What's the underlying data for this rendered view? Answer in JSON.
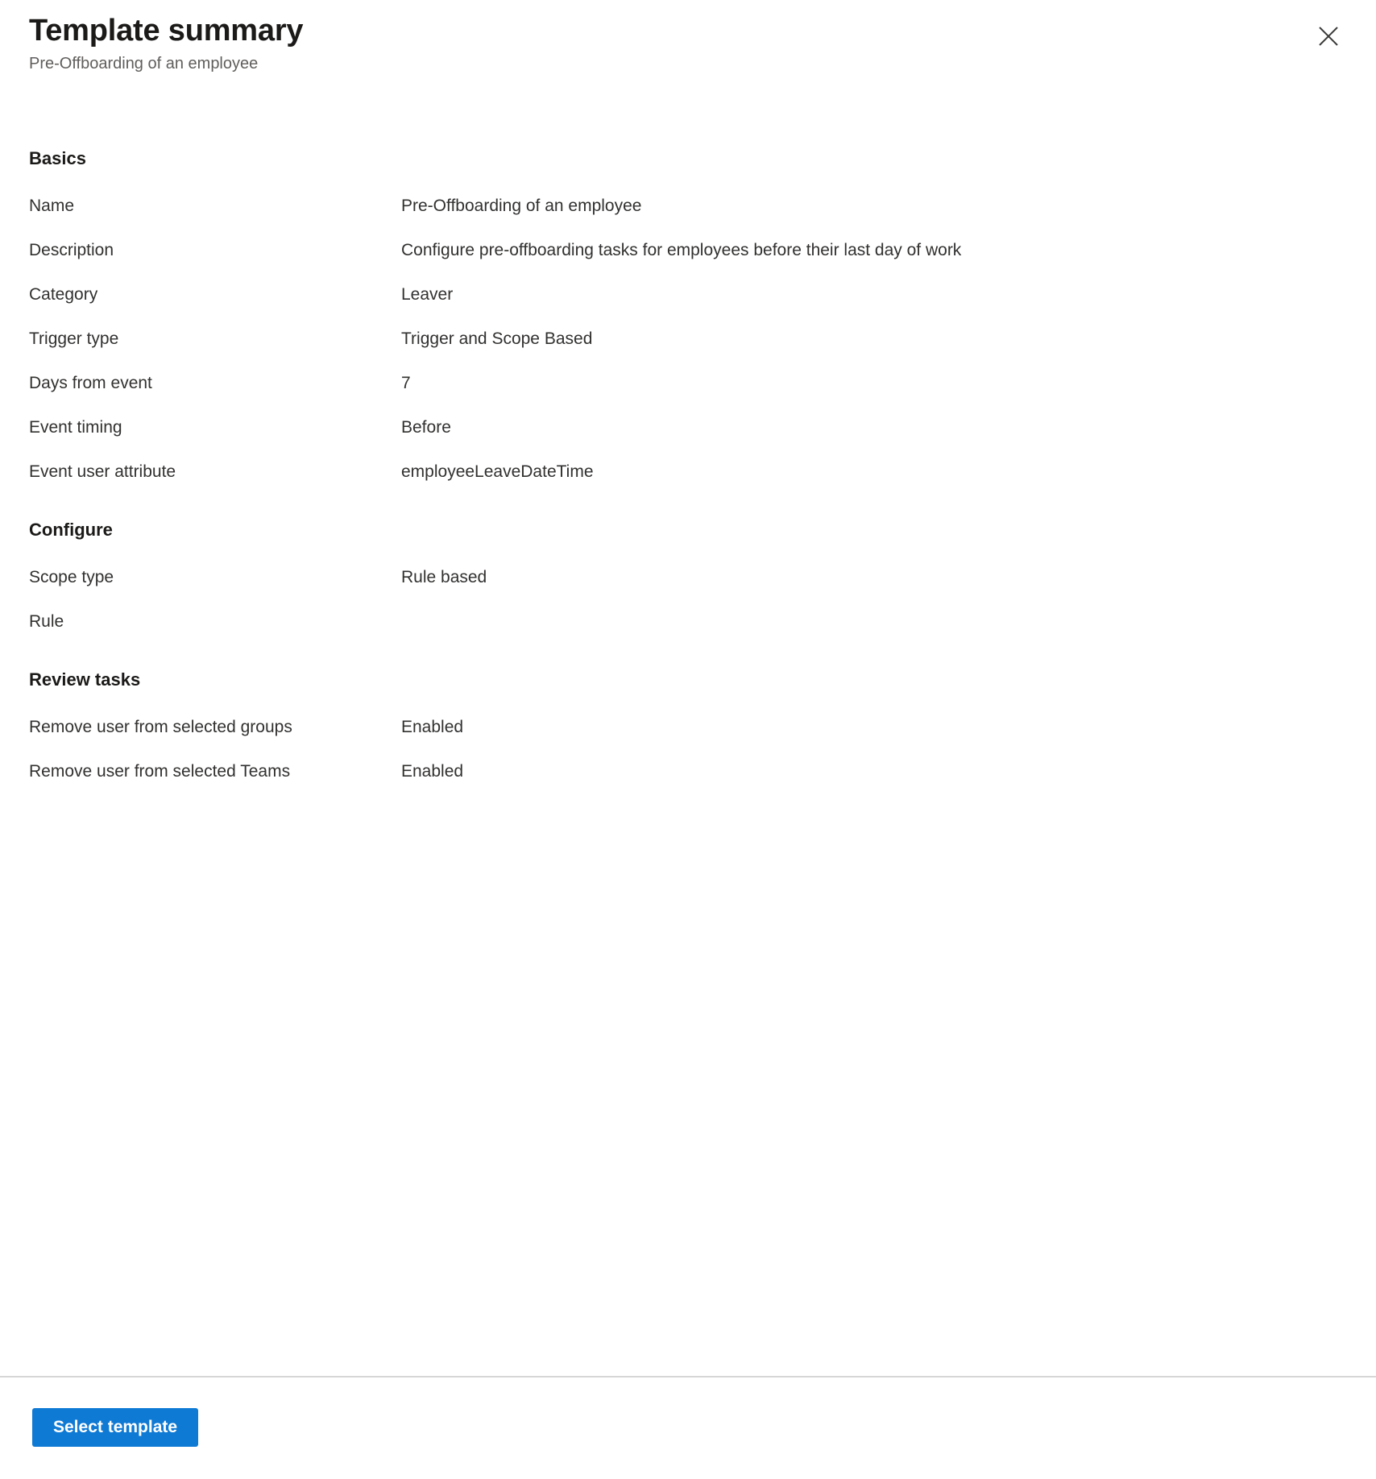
{
  "header": {
    "title": "Template summary",
    "subtitle": "Pre-Offboarding of an employee",
    "close_icon": "close-icon"
  },
  "sections": [
    {
      "id": "basics",
      "title": "Basics",
      "rows": [
        {
          "label": "Name",
          "value": "Pre-Offboarding of an employee"
        },
        {
          "label": "Description",
          "value": "Configure pre-offboarding tasks for employees before their last day of work"
        },
        {
          "label": "Category",
          "value": "Leaver"
        },
        {
          "label": "Trigger type",
          "value": "Trigger and Scope Based"
        },
        {
          "label": "Days from event",
          "value": "7"
        },
        {
          "label": "Event timing",
          "value": "Before"
        },
        {
          "label": "Event user attribute",
          "value": "employeeLeaveDateTime"
        }
      ]
    },
    {
      "id": "configure",
      "title": "Configure",
      "rows": [
        {
          "label": "Scope type",
          "value": "Rule based"
        },
        {
          "label": "Rule",
          "value": ""
        }
      ]
    },
    {
      "id": "review",
      "title": "Review tasks",
      "rows": [
        {
          "label": "Remove user from selected groups",
          "value": "Enabled"
        },
        {
          "label": "Remove user from selected Teams",
          "value": "Enabled"
        }
      ]
    }
  ],
  "footer": {
    "select_template_label": "Select template"
  },
  "colors": {
    "primary": "#0f7ad4",
    "text": "#323130",
    "muted_text": "#605e5c",
    "heading": "#1b1a19",
    "divider": "#d6d6d6",
    "background": "#ffffff"
  }
}
